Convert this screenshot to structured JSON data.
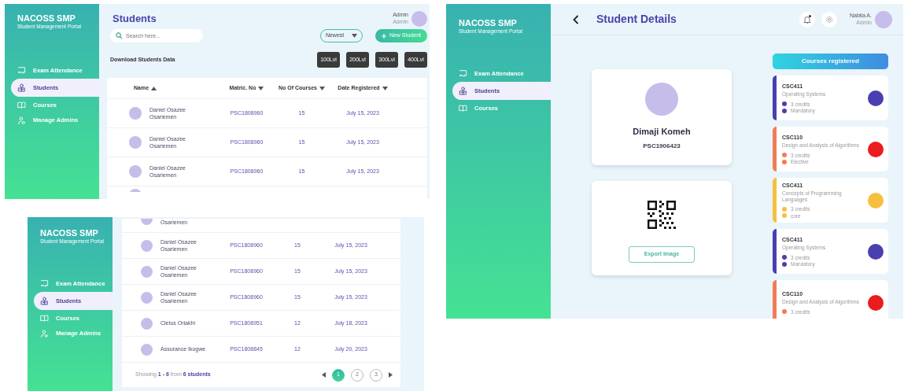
{
  "screens": [
    {
      "kind": "student_list",
      "brand": {
        "title": "NACOSS SMP",
        "subtitle": "Student Management Portal"
      },
      "nav": [
        {
          "label": "Exam Attendance",
          "selected": false
        },
        {
          "label": "Students",
          "selected": true
        },
        {
          "label": "Courses",
          "selected": false
        },
        {
          "label": "Manage Admins",
          "selected": false
        }
      ],
      "title": "Students",
      "user": {
        "name": "Admin",
        "role": "Admin"
      },
      "search": {
        "placeholder": "Search here..."
      },
      "sort": {
        "value": "Newest"
      },
      "new_button": "New Student",
      "download_label": "Download Students Data",
      "level_buttons": [
        "100Lvl",
        "200Lvl",
        "300Lvl",
        "400Lvl"
      ],
      "table": {
        "columns": [
          {
            "label": "Name",
            "ascending": true
          },
          {
            "label": "Matric. No",
            "ascending": false
          },
          {
            "label": "No Of Courses",
            "ascending": false
          },
          {
            "label": "Date Registered",
            "ascending": false
          }
        ],
        "rows": [
          {
            "kind": "full",
            "name": "Daniel Osazee Osariemen",
            "matric": "PSC1808960",
            "courses": "15",
            "date": "July 15, 2023"
          },
          {
            "kind": "full",
            "name": "Daniel Osazee Osariemen",
            "matric": "PSC1808960",
            "courses": "15",
            "date": "July 15, 2023"
          },
          {
            "kind": "full",
            "name": "Daniel Osazee Osariemen",
            "matric": "PSC1808960",
            "courses": "15",
            "date": "July 15, 2023"
          },
          {
            "kind": "cut_below"
          }
        ]
      }
    },
    {
      "kind": "student_list",
      "brand": {
        "title": "NACOSS SMP",
        "subtitle": "Student Management Portal"
      },
      "nav": [
        {
          "label": "Exam Attendance",
          "selected": false
        },
        {
          "label": "Students",
          "selected": true
        },
        {
          "label": "Courses",
          "selected": false
        },
        {
          "label": "Manage Admins",
          "selected": false
        }
      ],
      "table": {
        "rows": [
          {
            "kind": "cut_above",
            "name": "Osariemen"
          },
          {
            "kind": "full",
            "name": "Daniel Osazee Osariemen",
            "matric": "PSC1808960",
            "courses": "15",
            "date": "July 15, 2023"
          },
          {
            "kind": "full",
            "name": "Daniel Osazee Osariemen",
            "matric": "PSC1808960",
            "courses": "15",
            "date": "July 15, 2023"
          },
          {
            "kind": "full",
            "name": "Daniel Osazee Osariemen",
            "matric": "PSC1808960",
            "courses": "15",
            "date": "July 15, 2023"
          },
          {
            "kind": "full",
            "name": "Cletus Oriakhi",
            "matric": "PSC1808951",
            "courses": "12",
            "date": "July 18, 2023"
          },
          {
            "kind": "full",
            "name": "Assurance Ikogwe",
            "matric": "PSC1808845",
            "courses": "12",
            "date": "July 20, 2023"
          }
        ],
        "summary": "Showing **1 - 6** from **6 students**",
        "pages": [
          {
            "label": "1",
            "selected": true
          },
          {
            "label": "2",
            "selected": false
          },
          {
            "label": "3",
            "selected": false
          }
        ]
      }
    },
    {
      "kind": "student_details",
      "brand": {
        "title": "NACOSS SMP",
        "subtitle": "Student Management Portal"
      },
      "nav": [
        {
          "label": "Exam Attendance",
          "selected": false
        },
        {
          "label": "Students",
          "selected": true
        },
        {
          "label": "Courses",
          "selected": false
        }
      ],
      "title": "Student Details",
      "notifications": {
        "unread": true
      },
      "user": {
        "name": "Nabila A.",
        "role": "Admin"
      },
      "profile": {
        "name": "Dimaji Komeh",
        "matric": "PSC1906423"
      },
      "export_button": "Export Image",
      "courses_heading": "Courses registered",
      "courses": [
        {
          "code": "CSC411",
          "title": "Operating Systems",
          "credits": "3 credits",
          "type": "Mandatory",
          "color": "#4a3fb0",
          "badge": {
            "color": "#4a3fb0"
          }
        },
        {
          "code": "CSC110",
          "title": "Design and Analysis of Algorithms",
          "credits": "3 credits",
          "type": "Elective",
          "color": "#f07d55",
          "badge": {
            "color": "#ea1c1c"
          }
        },
        {
          "code": "CSC411",
          "title": "Concepts of Programming Languages",
          "credits": "3 credits",
          "type": "core",
          "color": "#f6c03e",
          "badge": {
            "color": "#f6c03e"
          }
        },
        {
          "code": "CSC411",
          "title": "Operating Systems",
          "credits": "3 credits",
          "type": "Mandatory",
          "color": "#4a3fb0",
          "badge": {
            "color": "#4a3fb0"
          }
        },
        {
          "code": "CSC110",
          "title": "Design and Analysis of Algorithms",
          "credits": "3 credits",
          "color": "#f07d55",
          "badge": {
            "color": "#ea1c1c"
          }
        }
      ]
    }
  ]
}
